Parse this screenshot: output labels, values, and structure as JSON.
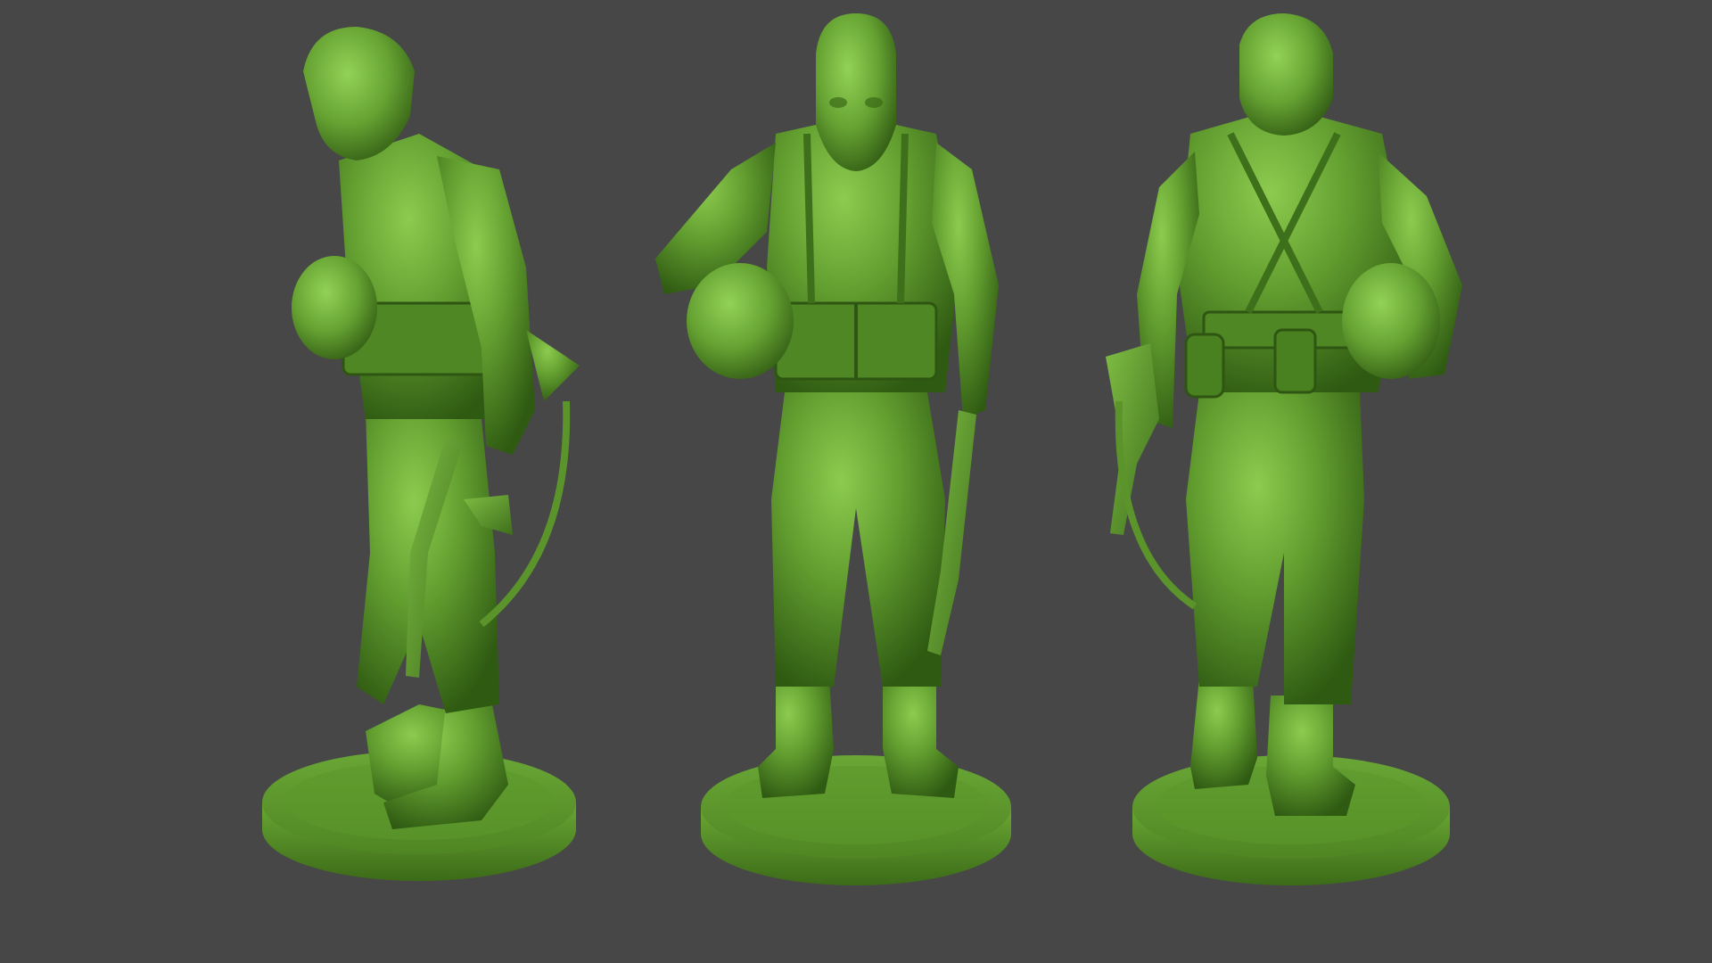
{
  "scene": {
    "background_color": "#474747",
    "figure_color": "#5f9a2e",
    "figure_highlight": "#86c24a",
    "figure_shadow": "#3a6a17",
    "views": [
      "side",
      "front",
      "back"
    ]
  }
}
